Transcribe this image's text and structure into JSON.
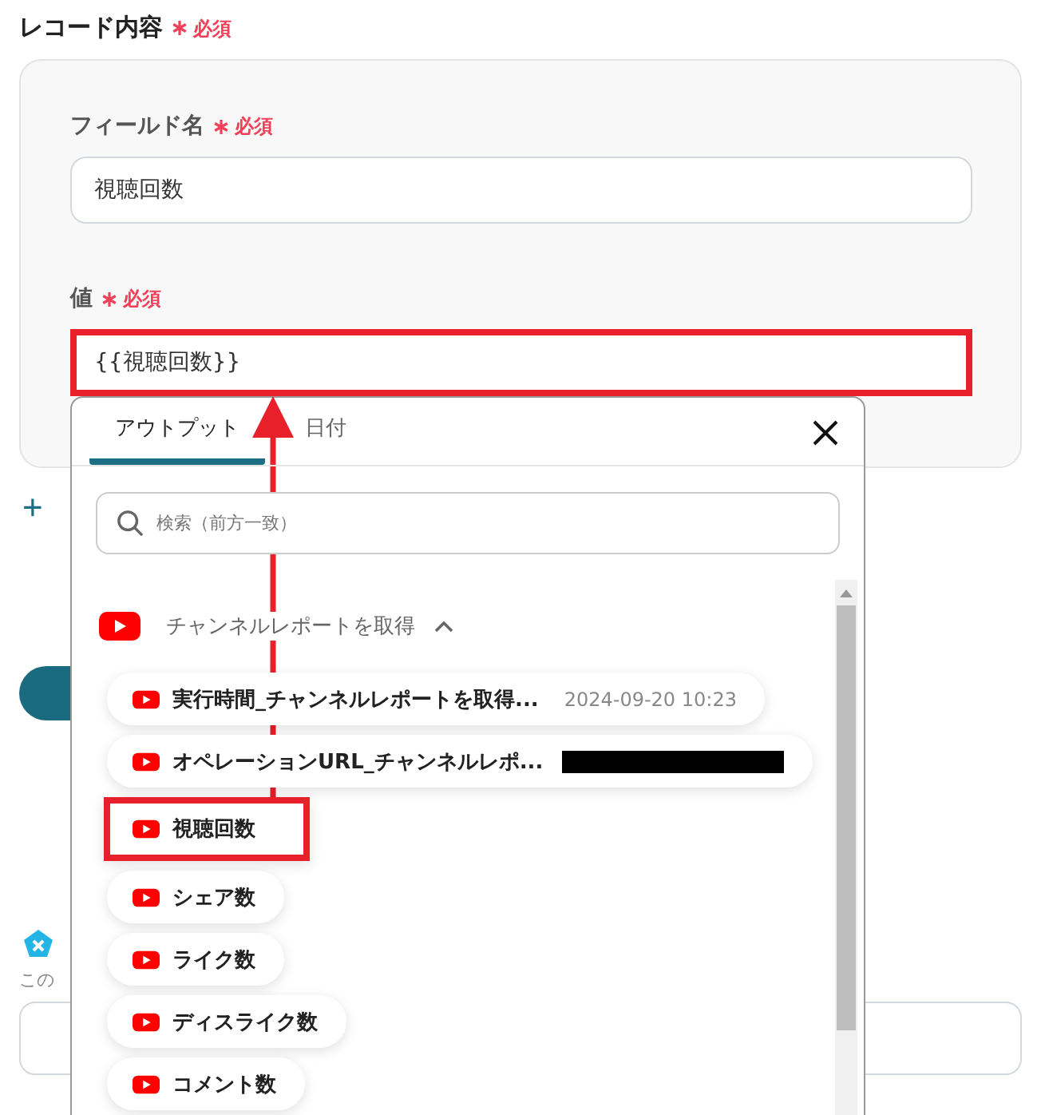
{
  "section": {
    "title": "レコード内容",
    "required": "必須"
  },
  "fields": [
    {
      "label": "フィールド名",
      "required": "必須",
      "value": "視聴回数",
      "highlighted": false
    },
    {
      "label": "値",
      "required": "必須",
      "value": "{{視聴回数}}",
      "highlighted": true
    }
  ],
  "add_button": "+",
  "lower": {
    "note": "この"
  },
  "popup": {
    "tabs": [
      {
        "label": "アウトプット",
        "selected": true
      },
      {
        "label": "日付",
        "selected": false
      }
    ],
    "search": {
      "placeholder": "検索（前方一致）"
    },
    "group": {
      "title": "チャンネルレポートを取得",
      "expanded": true
    },
    "items": [
      {
        "label": "実行時間_チャンネルレポートを取得...",
        "value": "2024-09-20 10:23",
        "redacted": false,
        "highlighted": false
      },
      {
        "label": "オペレーションURL_チャンネルレポ...",
        "redacted": true,
        "highlighted": false
      },
      {
        "label": "視聴回数",
        "redacted": false,
        "highlighted": true
      },
      {
        "label": "シェア数",
        "redacted": false,
        "highlighted": false
      },
      {
        "label": "ライク数",
        "redacted": false,
        "highlighted": false
      },
      {
        "label": "ディスライク数",
        "redacted": false,
        "highlighted": false
      },
      {
        "label": "コメント数",
        "redacted": false,
        "highlighted": false
      }
    ]
  }
}
